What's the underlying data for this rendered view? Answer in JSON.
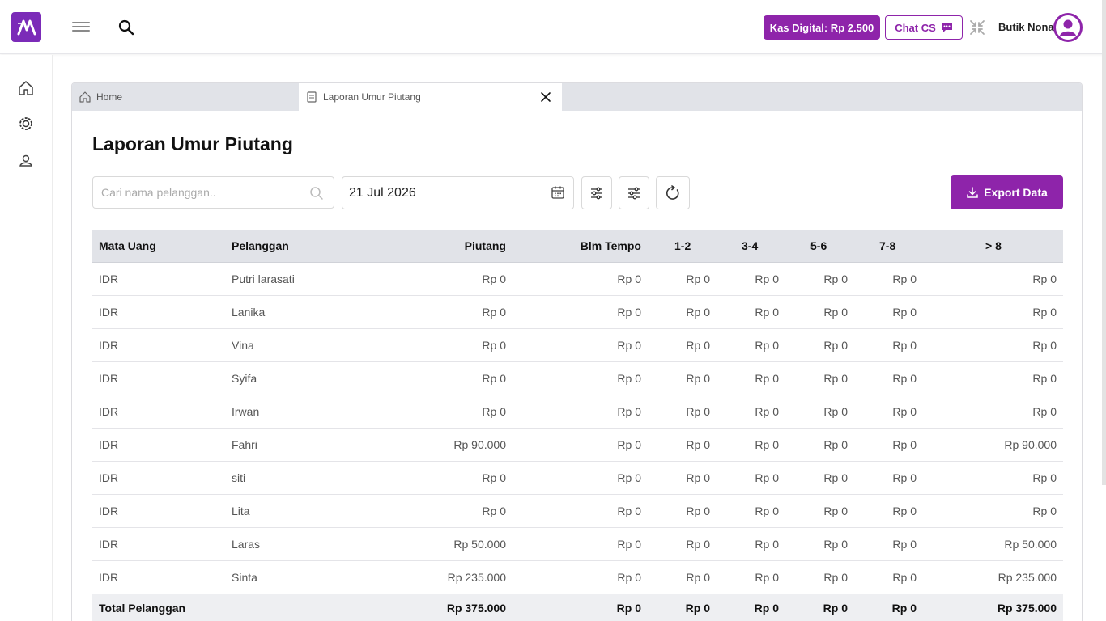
{
  "header": {
    "kas_label": "Kas Digital: Rp 2.500",
    "chat_label": "Chat CS",
    "user_name": "Butik Nona"
  },
  "tabs": {
    "home_label": "Home",
    "active_label": "Laporan Umur Piutang"
  },
  "page": {
    "title": "Laporan Umur Piutang",
    "search_placeholder": "Cari nama pelanggan..",
    "date_value": "21 Jul 2026",
    "export_label": "Export Data"
  },
  "table": {
    "headers": [
      "Mata Uang",
      "Pelanggan",
      "Piutang",
      "Blm Tempo",
      "1-2",
      "3-4",
      "5-6",
      "7-8",
      "> 8"
    ],
    "rows": [
      [
        "IDR",
        "Putri larasati",
        "Rp 0",
        "Rp 0",
        "Rp 0",
        "Rp 0",
        "Rp 0",
        "Rp 0",
        "Rp 0"
      ],
      [
        "IDR",
        "Lanika",
        "Rp 0",
        "Rp 0",
        "Rp 0",
        "Rp 0",
        "Rp 0",
        "Rp 0",
        "Rp 0"
      ],
      [
        "IDR",
        "Vina",
        "Rp 0",
        "Rp 0",
        "Rp 0",
        "Rp 0",
        "Rp 0",
        "Rp 0",
        "Rp 0"
      ],
      [
        "IDR",
        "Syifa",
        "Rp 0",
        "Rp 0",
        "Rp 0",
        "Rp 0",
        "Rp 0",
        "Rp 0",
        "Rp 0"
      ],
      [
        "IDR",
        "Irwan",
        "Rp 0",
        "Rp 0",
        "Rp 0",
        "Rp 0",
        "Rp 0",
        "Rp 0",
        "Rp 0"
      ],
      [
        "IDR",
        "Fahri",
        "Rp 90.000",
        "Rp 0",
        "Rp 0",
        "Rp 0",
        "Rp 0",
        "Rp 0",
        "Rp 90.000"
      ],
      [
        "IDR",
        "siti",
        "Rp 0",
        "Rp 0",
        "Rp 0",
        "Rp 0",
        "Rp 0",
        "Rp 0",
        "Rp 0"
      ],
      [
        "IDR",
        "Lita",
        "Rp 0",
        "Rp 0",
        "Rp 0",
        "Rp 0",
        "Rp 0",
        "Rp 0",
        "Rp 0"
      ],
      [
        "IDR",
        "Laras",
        "Rp 50.000",
        "Rp 0",
        "Rp 0",
        "Rp 0",
        "Rp 0",
        "Rp 0",
        "Rp 50.000"
      ],
      [
        "IDR",
        "Sinta",
        "Rp 235.000",
        "Rp 0",
        "Rp 0",
        "Rp 0",
        "Rp 0",
        "Rp 0",
        "Rp 235.000"
      ]
    ],
    "total": [
      "Total Pelanggan",
      "",
      "Rp 375.000",
      "Rp 0",
      "Rp 0",
      "Rp 0",
      "Rp 0",
      "Rp 0",
      "Rp 375.000"
    ]
  },
  "colors": {
    "accent": "#8e24aa",
    "header_bg": "#e1e3e8"
  },
  "icons": {
    "sidebar": [
      "home-icon",
      "settings-cog-icon",
      "contacts-icon"
    ],
    "toolbar": [
      "filter-sliders-icon",
      "filter-sliders-icon",
      "refresh-icon"
    ]
  }
}
